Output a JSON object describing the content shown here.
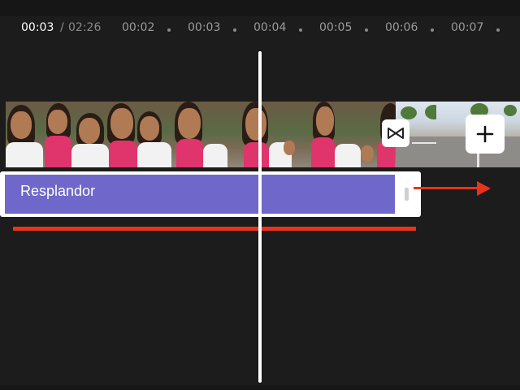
{
  "timeline": {
    "current_time": "00:03",
    "separator": "/",
    "total_time": "02:26",
    "ticks": [
      "00:02",
      "00:03",
      "00:04",
      "00:05",
      "00:06",
      "00:07"
    ]
  },
  "effect_clip": {
    "label": "Resplandor"
  },
  "icons": {
    "transition": "transition-bowtie-icon",
    "add": "plus-icon"
  },
  "colors": {
    "effect_clip": "#6f67c9",
    "annotation": "#e8331e",
    "playhead": "#ffffff",
    "background": "#1c1c1c"
  }
}
